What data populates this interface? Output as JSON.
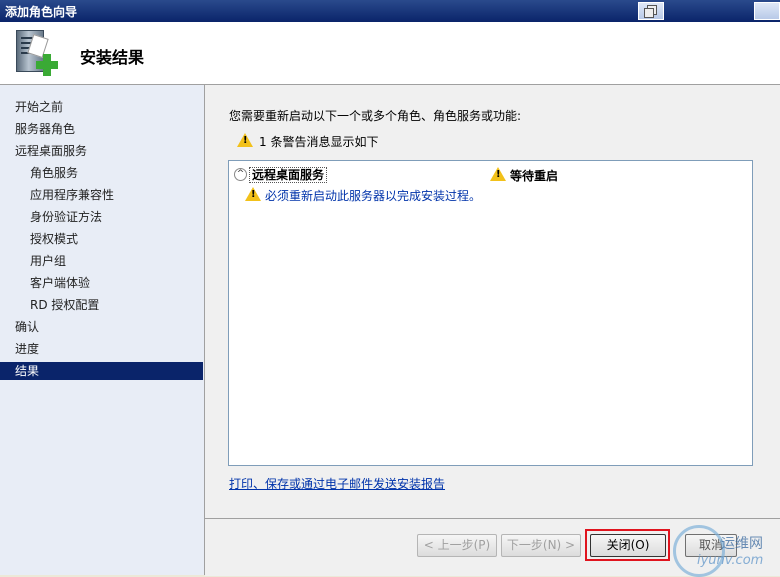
{
  "window": {
    "title": "添加角色向导"
  },
  "header": {
    "title": "安装结果"
  },
  "sidebar": {
    "items": [
      {
        "label": "开始之前",
        "level": 0,
        "active": false
      },
      {
        "label": "服务器角色",
        "level": 0,
        "active": false
      },
      {
        "label": "远程桌面服务",
        "level": 0,
        "active": false
      },
      {
        "label": "角色服务",
        "level": 1,
        "active": false
      },
      {
        "label": "应用程序兼容性",
        "level": 1,
        "active": false
      },
      {
        "label": "身份验证方法",
        "level": 1,
        "active": false
      },
      {
        "label": "授权模式",
        "level": 1,
        "active": false
      },
      {
        "label": "用户组",
        "level": 1,
        "active": false
      },
      {
        "label": "客户端体验",
        "level": 1,
        "active": false
      },
      {
        "label": "RD 授权配置",
        "level": 1,
        "active": false
      },
      {
        "label": "确认",
        "level": 0,
        "active": false
      },
      {
        "label": "进度",
        "level": 0,
        "active": false
      },
      {
        "label": "结果",
        "level": 0,
        "active": true
      }
    ]
  },
  "content": {
    "intro": "您需要重新启动以下一个或多个角色、角色服务或功能:",
    "warning_summary": "1 条警告消息显示如下",
    "result": {
      "role_name": "远程桌面服务",
      "status": "等待重启",
      "detail": "必须重新启动此服务器以完成安装过程。"
    },
    "report_link": "打印、保存或通过电子邮件发送安装报告"
  },
  "footer": {
    "prev_label": "< 上一步(P)",
    "next_label": "下一步(N) >",
    "close_label": "关闭(O)",
    "cancel_label": "取消"
  },
  "watermark": {
    "cn": "运维网",
    "en": "iyunv.com"
  },
  "colors": {
    "active_nav": "#0a246a",
    "link": "#0033aa",
    "highlight": "#e0141e",
    "warning": "#f2c11a"
  }
}
